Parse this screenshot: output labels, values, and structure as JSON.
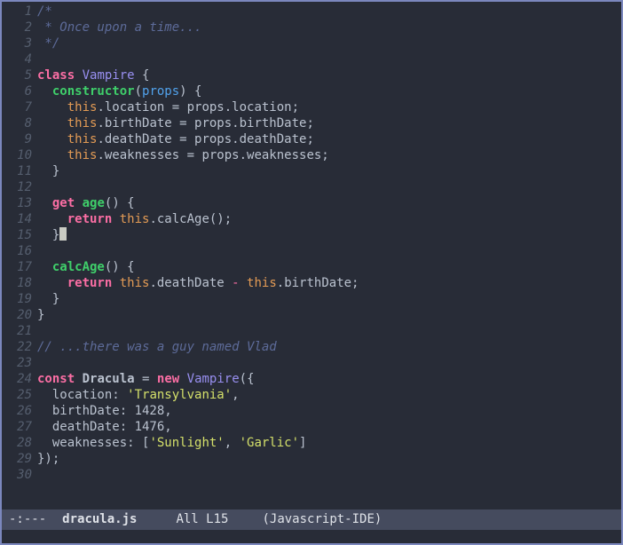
{
  "colors": {
    "border": "#7b87bd",
    "bg": "#282c37",
    "fg": "#bac2cf",
    "ln": "#555e6e",
    "cm": "#5d6b99",
    "kw": "#fb6ea4",
    "fn": "#3fcf6a",
    "ty": "#988ff0",
    "pr": "#51a2ec",
    "th": "#e39b55",
    "st": "#d4e06a",
    "cursor": "#c9cbc3",
    "mlbg": "#454b5e",
    "mlfg": "#dfe2e8"
  },
  "editor": {
    "cursor_line": 15,
    "lines": [
      {
        "n": "1",
        "tokens": [
          [
            "cm",
            "/*"
          ]
        ]
      },
      {
        "n": "2",
        "tokens": [
          [
            "cm",
            " * Once upon a time..."
          ]
        ]
      },
      {
        "n": "3",
        "tokens": [
          [
            "cm",
            " */"
          ]
        ]
      },
      {
        "n": "4",
        "tokens": []
      },
      {
        "n": "5",
        "tokens": [
          [
            "kw",
            "class"
          ],
          [
            "pl",
            " "
          ],
          [
            "ty",
            "Vampire"
          ],
          [
            "pl",
            " {"
          ]
        ]
      },
      {
        "n": "6",
        "tokens": [
          [
            "pl",
            "  "
          ],
          [
            "fn",
            "constructor"
          ],
          [
            "pl",
            "("
          ],
          [
            "pr",
            "props"
          ],
          [
            "pl",
            ") {"
          ]
        ]
      },
      {
        "n": "7",
        "tokens": [
          [
            "pl",
            "    "
          ],
          [
            "th",
            "this"
          ],
          [
            "pl",
            ".location = props.location;"
          ]
        ]
      },
      {
        "n": "8",
        "tokens": [
          [
            "pl",
            "    "
          ],
          [
            "th",
            "this"
          ],
          [
            "pl",
            ".birthDate = props.birthDate;"
          ]
        ]
      },
      {
        "n": "9",
        "tokens": [
          [
            "pl",
            "    "
          ],
          [
            "th",
            "this"
          ],
          [
            "pl",
            ".deathDate = props.deathDate;"
          ]
        ]
      },
      {
        "n": "10",
        "tokens": [
          [
            "pl",
            "    "
          ],
          [
            "th",
            "this"
          ],
          [
            "pl",
            ".weaknesses = props.weaknesses;"
          ]
        ]
      },
      {
        "n": "11",
        "tokens": [
          [
            "pl",
            "  }"
          ]
        ]
      },
      {
        "n": "12",
        "tokens": []
      },
      {
        "n": "13",
        "tokens": [
          [
            "pl",
            "  "
          ],
          [
            "kw",
            "get"
          ],
          [
            "pl",
            " "
          ],
          [
            "fn",
            "age"
          ],
          [
            "pl",
            "() {"
          ]
        ]
      },
      {
        "n": "14",
        "tokens": [
          [
            "pl",
            "    "
          ],
          [
            "kw",
            "return"
          ],
          [
            "pl",
            " "
          ],
          [
            "th",
            "this"
          ],
          [
            "pl",
            ".calcAge();"
          ]
        ]
      },
      {
        "n": "15",
        "tokens": [
          [
            "pl",
            "  }"
          ],
          [
            "cur",
            ""
          ]
        ]
      },
      {
        "n": "16",
        "tokens": []
      },
      {
        "n": "17",
        "tokens": [
          [
            "pl",
            "  "
          ],
          [
            "fn",
            "calcAge"
          ],
          [
            "pl",
            "() {"
          ]
        ]
      },
      {
        "n": "18",
        "tokens": [
          [
            "pl",
            "    "
          ],
          [
            "kw",
            "return"
          ],
          [
            "pl",
            " "
          ],
          [
            "th",
            "this"
          ],
          [
            "pl",
            ".deathDate "
          ],
          [
            "op",
            "-"
          ],
          [
            "pl",
            " "
          ],
          [
            "th",
            "this"
          ],
          [
            "pl",
            ".birthDate;"
          ]
        ]
      },
      {
        "n": "19",
        "tokens": [
          [
            "pl",
            "  }"
          ]
        ]
      },
      {
        "n": "20",
        "tokens": [
          [
            "pl",
            "}"
          ]
        ]
      },
      {
        "n": "21",
        "tokens": []
      },
      {
        "n": "22",
        "tokens": [
          [
            "cm",
            "// ...there was a guy named Vlad"
          ]
        ]
      },
      {
        "n": "23",
        "tokens": []
      },
      {
        "n": "24",
        "tokens": [
          [
            "kw",
            "const"
          ],
          [
            "pl",
            " "
          ],
          [
            "df",
            "Dracula"
          ],
          [
            "pl",
            " = "
          ],
          [
            "kw",
            "new"
          ],
          [
            "pl",
            " "
          ],
          [
            "ty",
            "Vampire"
          ],
          [
            "pl",
            "({"
          ]
        ]
      },
      {
        "n": "25",
        "tokens": [
          [
            "pl",
            "  location: "
          ],
          [
            "st",
            "'Transylvania'"
          ],
          [
            "pl",
            ","
          ]
        ]
      },
      {
        "n": "26",
        "tokens": [
          [
            "pl",
            "  birthDate: 1428,"
          ]
        ]
      },
      {
        "n": "27",
        "tokens": [
          [
            "pl",
            "  deathDate: 1476,"
          ]
        ]
      },
      {
        "n": "28",
        "tokens": [
          [
            "pl",
            "  weaknesses: ["
          ],
          [
            "st",
            "'Sunlight'"
          ],
          [
            "pl",
            ", "
          ],
          [
            "st",
            "'Garlic'"
          ],
          [
            "pl",
            "]"
          ]
        ]
      },
      {
        "n": "29",
        "tokens": [
          [
            "pl",
            "});"
          ]
        ]
      },
      {
        "n": "30",
        "tokens": []
      }
    ]
  },
  "modeline": {
    "state": "-:---",
    "file": "dracula.js",
    "position": "All L15",
    "mode": "(Javascript-IDE)"
  }
}
